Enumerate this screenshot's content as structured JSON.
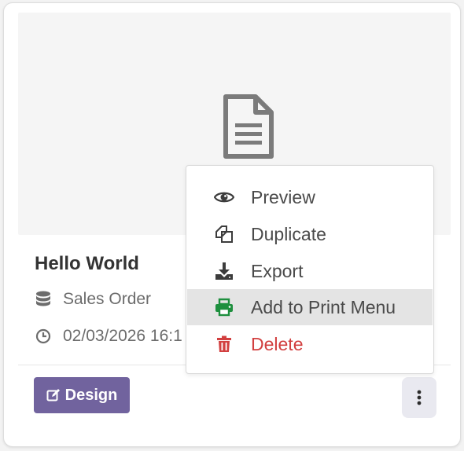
{
  "report": {
    "title": "Hello World",
    "model": "Sales Order",
    "date": "02/03/2026 16:1"
  },
  "actions": {
    "design_label": "Design"
  },
  "menu": {
    "items": [
      {
        "label": "Preview",
        "icon": "eye-icon"
      },
      {
        "label": "Duplicate",
        "icon": "copy-icon"
      },
      {
        "label": "Export",
        "icon": "download-icon"
      },
      {
        "label": "Add to Print Menu",
        "icon": "print-icon",
        "highlighted": true,
        "icon_color": "#1e8f3e"
      },
      {
        "label": "Delete",
        "icon": "trash-icon",
        "color": "#d23f3f"
      }
    ]
  },
  "colors": {
    "primary": "#71639e",
    "danger": "#d23f3f",
    "success": "#1e8f3e"
  }
}
